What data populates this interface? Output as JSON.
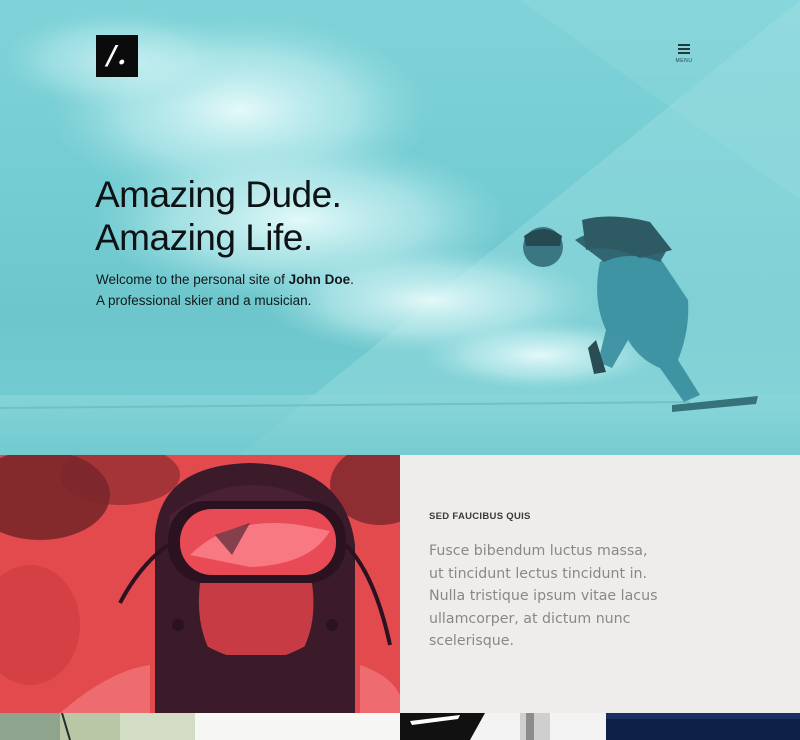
{
  "header": {
    "logo_text": "/.",
    "menu_label": "MENU"
  },
  "hero": {
    "headline_line1": "Amazing Dude.",
    "headline_line2": "Amazing Life.",
    "intro_prefix": "Welcome to the personal site of ",
    "intro_name": "John Doe",
    "intro_suffix": ".",
    "intro_line2": "A professional skier and a musician."
  },
  "feature": {
    "kicker": "SED FAUCIBUS QUIS",
    "body_lines": [
      "Fusce bibendum luctus massa,",
      "ut tincidunt lectus tincidunt in.",
      "Nulla tristique ipsum vitae lacus",
      "ullamcorper, at dictum nunc",
      "scelerisque."
    ]
  },
  "colors": {
    "hero_tint": "#74cdd3",
    "feature_red": "#e2474b",
    "feature_panel": "#efedeb",
    "body_text": "#8b8884"
  },
  "icons": [
    "menu-icon",
    "logo-mark"
  ]
}
